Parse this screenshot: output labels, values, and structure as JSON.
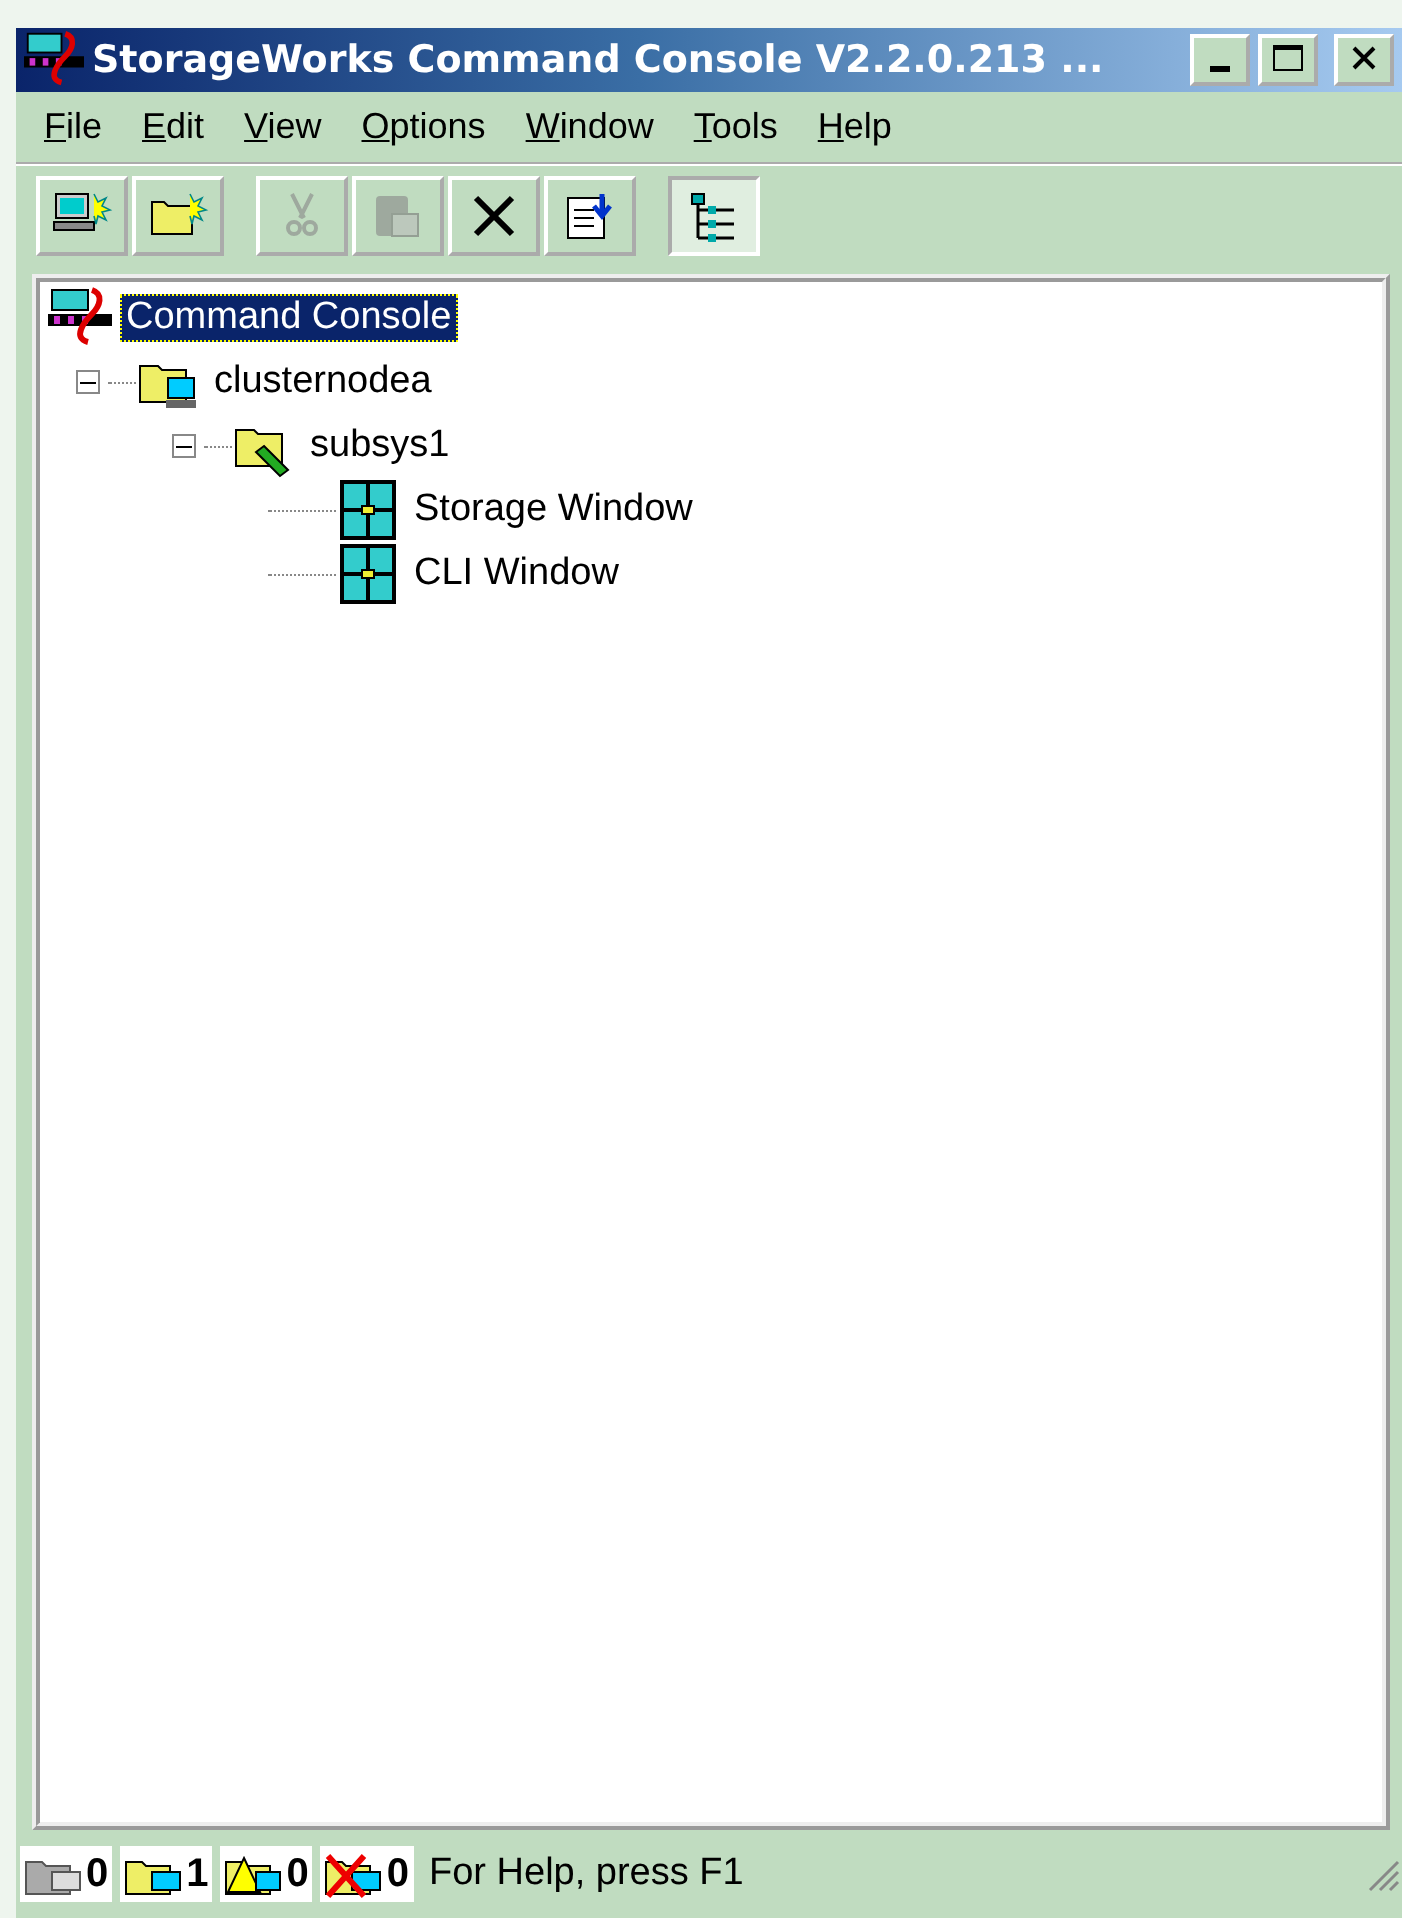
{
  "window": {
    "title": "StorageWorks Command Console V2.2.0.213   ..."
  },
  "menu": [
    "File",
    "Edit",
    "View",
    "Options",
    "Window",
    "Tools",
    "Help"
  ],
  "toolbar": [
    {
      "kind": "new-host",
      "disabled": false,
      "pressed": false
    },
    {
      "kind": "new-folder",
      "disabled": false,
      "pressed": false
    },
    {
      "kind": "cut",
      "disabled": true,
      "pressed": false
    },
    {
      "kind": "paste",
      "disabled": true,
      "pressed": false
    },
    {
      "kind": "delete",
      "disabled": false,
      "pressed": false
    },
    {
      "kind": "properties",
      "disabled": false,
      "pressed": false
    },
    {
      "kind": "tree",
      "disabled": false,
      "pressed": true
    }
  ],
  "tree": [
    {
      "label": "Command Console",
      "kind": "console",
      "selected": true,
      "children": [
        {
          "label": "clusternodea",
          "kind": "host",
          "selected": false,
          "expanded": true,
          "children": [
            {
              "label": "subsys1",
              "kind": "subsystem",
              "selected": false,
              "expanded": true,
              "children": [
                {
                  "label": "Storage Window",
                  "kind": "window",
                  "selected": false
                },
                {
                  "label": "CLI Window",
                  "kind": "window",
                  "selected": false
                }
              ]
            }
          ]
        }
      ]
    }
  ],
  "status_bar": {
    "counters": [
      {
        "kind": "offline",
        "count": "0"
      },
      {
        "kind": "normal",
        "count": "1"
      },
      {
        "kind": "warning",
        "count": "0"
      },
      {
        "kind": "failed",
        "count": "0"
      }
    ],
    "message": "For Help, press F1"
  }
}
